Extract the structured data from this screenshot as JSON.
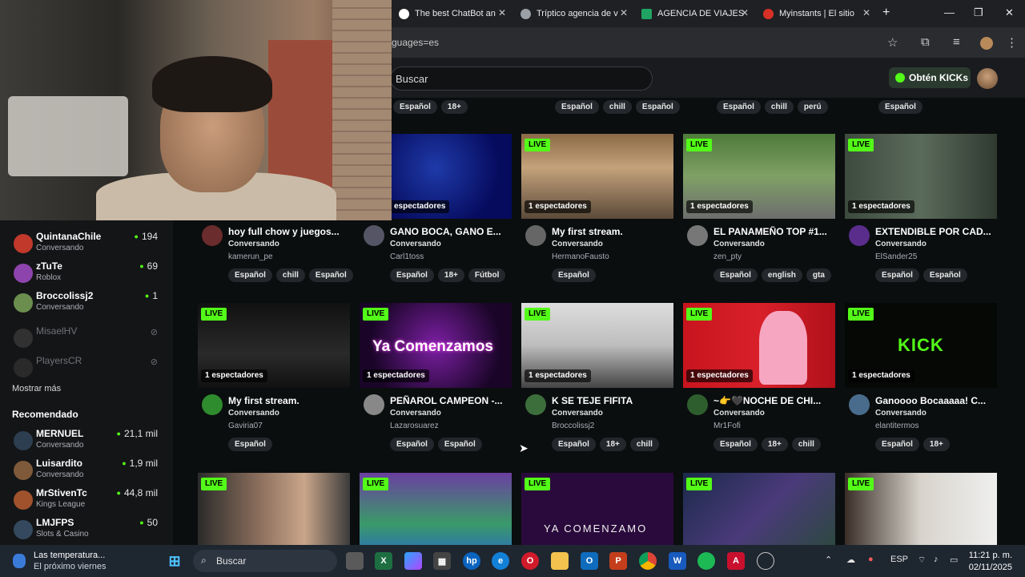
{
  "browser": {
    "tabs": [
      {
        "label": "The best ChatBot an",
        "color": "#ffffff"
      },
      {
        "label": "Tríptico agencia de v",
        "color": "#9aa0a6"
      },
      {
        "label": "AGENCIA DE VIAJES",
        "color": "#1fa463"
      },
      {
        "label": "Myinstants | El sitio",
        "color": "#d93025"
      }
    ],
    "new_tab": "+",
    "url": "guages=es",
    "window_controls": {
      "min": "—",
      "max": "❐",
      "close": "✕"
    }
  },
  "header": {
    "search_placeholder": "Buscar",
    "kicks_button": "Obtén KICKs",
    "accent": "#53fc18"
  },
  "sidebar": {
    "following": [
      {
        "name": "QuintanaChile",
        "sub": "Conversando",
        "count": "194",
        "color": "#c0392b"
      },
      {
        "name": "zTuTe",
        "sub": "Roblox",
        "count": "69",
        "color": "#8e44ad"
      },
      {
        "name": "Broccolissj2",
        "sub": "Conversando",
        "count": "1",
        "color": "#6b8e4e"
      }
    ],
    "offline": [
      {
        "name": "MisaelHV",
        "color": "#555"
      },
      {
        "name": "PlayersCR",
        "color": "#444"
      }
    ],
    "show_more": "Mostrar más",
    "recommended_title": "Recomendado",
    "recommended": [
      {
        "name": "MERNUEL",
        "sub": "Conversando",
        "count": "21,1 mil",
        "color": "#2c3e50"
      },
      {
        "name": "Luisardito",
        "sub": "Conversando",
        "count": "1,9 mil",
        "color": "#7f5a3a"
      },
      {
        "name": "MrStivenTc",
        "sub": "Kings League",
        "count": "44,8 mil",
        "color": "#a0522d"
      },
      {
        "name": "LMJFPS",
        "sub": "Slots & Casino",
        "count": "50",
        "color": "#34495e"
      }
    ]
  },
  "top_tags": [
    [
      "Español",
      "18+"
    ],
    [
      "Español",
      "chill",
      "Español"
    ],
    [
      "Español",
      "chill",
      "perú"
    ],
    [
      "Español"
    ]
  ],
  "live_label": "LIVE",
  "streams_row1": [
    {
      "title": "hoy full chow y juegos...",
      "category": "Conversando",
      "user": "kamerun_pe",
      "tags": [
        "Español",
        "chill",
        "Español"
      ],
      "viewers": "",
      "avatar": "#6a2c2c"
    },
    {
      "title": "GANO BOCA, GANO E...",
      "category": "Conversando",
      "user": "Carl1toss",
      "tags": [
        "Español",
        "18+",
        "Fútbol"
      ],
      "viewers": "espectadores",
      "avatar": "#556"
    },
    {
      "title": "My first stream.",
      "category": "Conversando",
      "user": "HermanoFausto",
      "tags": [
        "Español"
      ],
      "viewers": "1 espectadores",
      "avatar": "#666"
    },
    {
      "title": "EL PANAMEÑO TOP #1...",
      "category": "Conversando",
      "user": "zen_pty",
      "tags": [
        "Español",
        "english",
        "gta"
      ],
      "viewers": "1 espectadores",
      "avatar": "#777"
    },
    {
      "title": "EXTENDIBLE POR CAD...",
      "category": "Conversando",
      "user": "ElSander25",
      "tags": [
        "Español",
        "Español"
      ],
      "viewers": "1 espectadores",
      "avatar": "#5a2d8c"
    }
  ],
  "streams_row2": [
    {
      "title": "My first stream.",
      "category": "Conversando",
      "user": "Gaviria07",
      "tags": [
        "Español"
      ],
      "viewers": "1 espectadores",
      "avatar": "#2e8b2e",
      "overlay": ""
    },
    {
      "title": "PEÑAROL CAMPEON -...",
      "category": "Conversando",
      "user": "Lazarosuarez",
      "tags": [
        "Español",
        "Español"
      ],
      "viewers": "1 espectadores",
      "avatar": "#888",
      "overlay": "Ya Comenzamos"
    },
    {
      "title": "K SE TEJE FIFITA",
      "category": "Conversando",
      "user": "Broccolissj2",
      "tags": [
        "Español",
        "18+",
        "chill"
      ],
      "viewers": "1 espectadores",
      "avatar": "#3c6e3c",
      "overlay": ""
    },
    {
      "title": "~👉🖤NOCHE DE CHI...",
      "category": "Conversando",
      "user": "Mr1Fofi",
      "tags": [
        "Español",
        "18+",
        "chill"
      ],
      "viewers": "1 espectadores",
      "avatar": "#2e5e2e",
      "overlay": ""
    },
    {
      "title": "Ganoooo Bocaaaaa! C...",
      "category": "Conversando",
      "user": "elantitermos",
      "tags": [
        "Español",
        "18+"
      ],
      "viewers": "1 espectadores",
      "avatar": "#4a6c8c",
      "overlay": "KICK"
    }
  ],
  "streams_row3": [
    {
      "overlay": ""
    },
    {
      "overlay": ""
    },
    {
      "overlay": "YA COMENZAMO"
    },
    {
      "overlay": ""
    },
    {
      "overlay": ""
    }
  ],
  "taskbar": {
    "weather_title": "Las temperatura...",
    "weather_sub": "El próximo viernes",
    "search": "Buscar",
    "lang": "ESP",
    "time": "11:21 p. m.",
    "date": "02/11/2025"
  }
}
